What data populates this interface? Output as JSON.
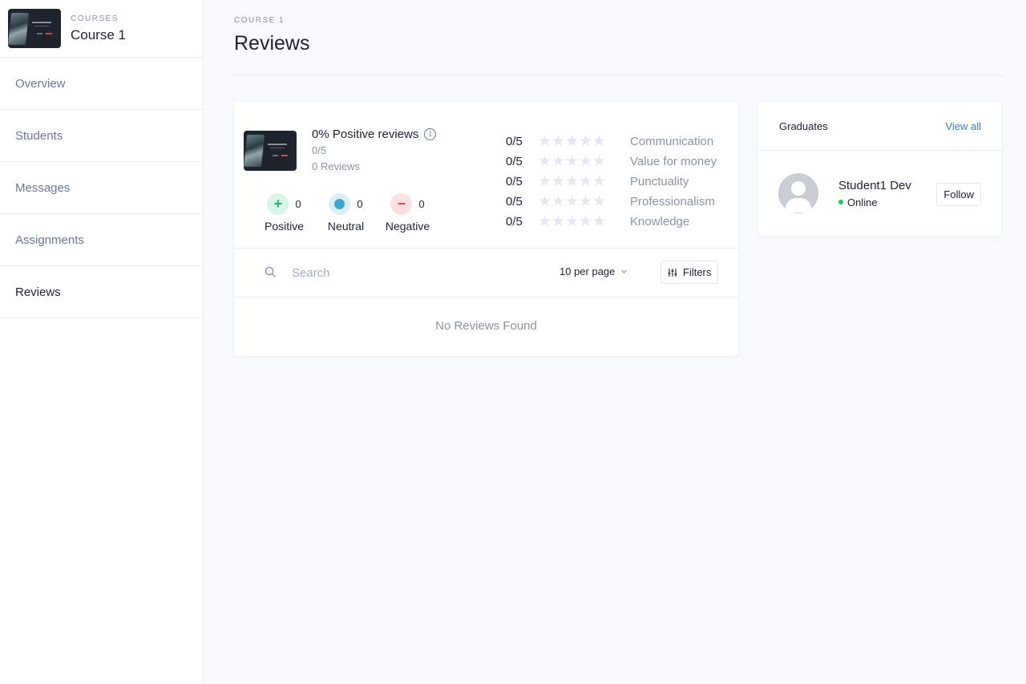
{
  "sidebar": {
    "course_kicker": "COURSES",
    "course_name": "Course 1",
    "items": [
      {
        "label": "Overview",
        "active": false
      },
      {
        "label": "Students",
        "active": false
      },
      {
        "label": "Messages",
        "active": false
      },
      {
        "label": "Assignments",
        "active": false
      },
      {
        "label": "Reviews",
        "active": true
      }
    ]
  },
  "header": {
    "kicker": "COURSE 1",
    "title": "Reviews"
  },
  "reviews": {
    "summary": {
      "positive_title": "0% Positive reviews",
      "score": "0/5",
      "count": "0 Reviews",
      "info_icon": "info-circle-icon"
    },
    "sentiments": [
      {
        "label": "Positive",
        "count": "0",
        "icon": "plus-icon"
      },
      {
        "label": "Neutral",
        "count": "0",
        "icon": "dot-icon"
      },
      {
        "label": "Negative",
        "count": "0",
        "icon": "minus-icon"
      }
    ],
    "ratings": [
      {
        "score": "0/5",
        "stars_filled": 0,
        "label": "Communication"
      },
      {
        "score": "0/5",
        "stars_filled": 0,
        "label": "Value for money"
      },
      {
        "score": "0/5",
        "stars_filled": 0,
        "label": "Punctuality"
      },
      {
        "score": "0/5",
        "stars_filled": 0,
        "label": "Professionalism"
      },
      {
        "score": "0/5",
        "stars_filled": 0,
        "label": "Knowledge"
      }
    ],
    "toolbar": {
      "search_placeholder": "Search",
      "per_page": "10 per page",
      "filters_label": "Filters"
    },
    "empty_text": "No Reviews Found"
  },
  "graduates": {
    "title": "Graduates",
    "view_all": "View all",
    "students": [
      {
        "name": "Student1 Dev",
        "status": "Online",
        "follow_label": "Follow"
      }
    ]
  },
  "colors": {
    "accent": "#3a7bd5",
    "positive": "#22b573",
    "neutral": "#3da5d0",
    "negative": "#e2414a",
    "online": "#22c55e"
  }
}
